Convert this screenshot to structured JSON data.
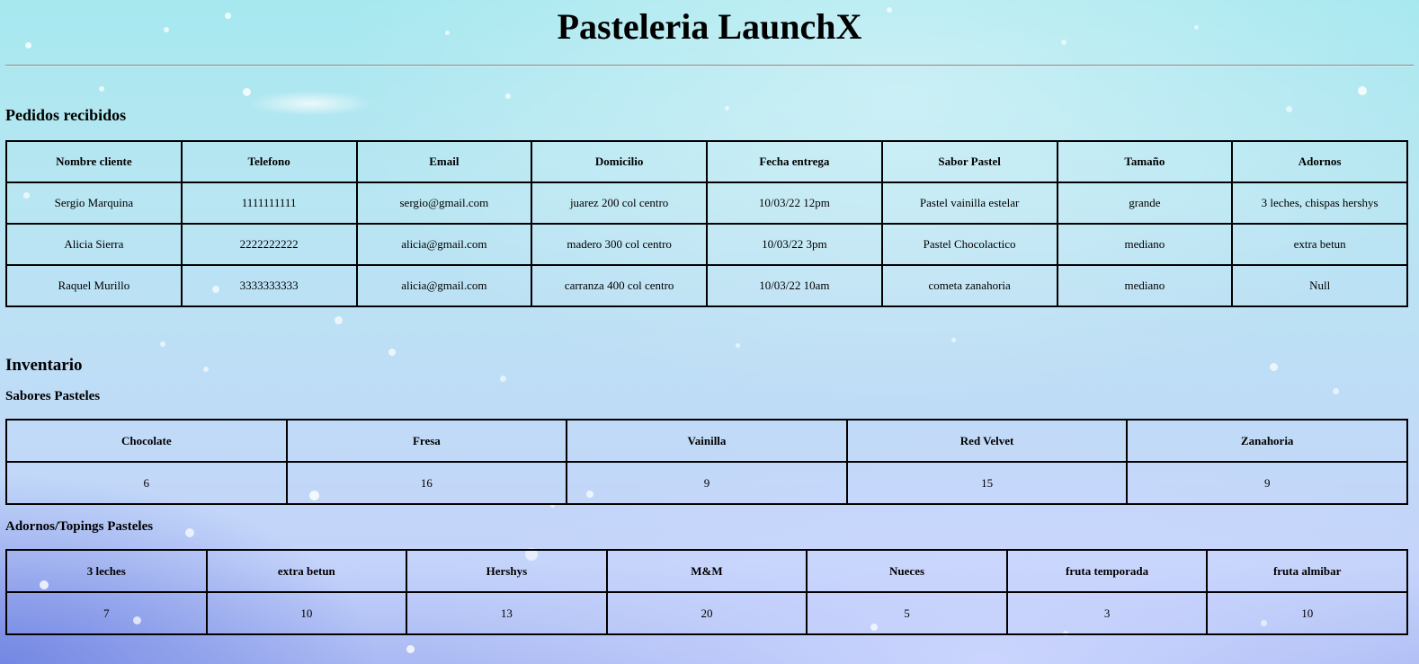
{
  "page": {
    "title": "Pasteleria LaunchX"
  },
  "orders": {
    "heading": "Pedidos recibidos",
    "columns": [
      "Nombre cliente",
      "Telefono",
      "Email",
      "Domicilio",
      "Fecha entrega",
      "Sabor Pastel",
      "Tamaño",
      "Adornos"
    ],
    "rows": [
      [
        "Sergio Marquina",
        "1111111111",
        "sergio@gmail.com",
        "juarez 200 col centro",
        "10/03/22 12pm",
        "Pastel vainilla estelar",
        "grande",
        "3 leches, chispas hershys"
      ],
      [
        "Alicia Sierra",
        "2222222222",
        "alicia@gmail.com",
        "madero 300 col centro",
        "10/03/22 3pm",
        "Pastel Chocolactico",
        "mediano",
        "extra betun"
      ],
      [
        "Raquel Murillo",
        "3333333333",
        "alicia@gmail.com",
        "carranza 400 col centro",
        "10/03/22 10am",
        "cometa zanahoria",
        "mediano",
        "Null"
      ]
    ]
  },
  "inventory": {
    "heading": "Inventario",
    "flavors": {
      "heading": "Sabores Pasteles",
      "columns": [
        "Chocolate",
        "Fresa",
        "Vainilla",
        "Red Velvet",
        "Zanahoria"
      ],
      "values": [
        "6",
        "16",
        "9",
        "15",
        "9"
      ]
    },
    "toppings": {
      "heading": "Adornos/Topings Pasteles",
      "columns": [
        "3 leches",
        "extra betun",
        "Hershys",
        "M&M",
        "Nueces",
        "fruta temporada",
        "fruta almibar"
      ],
      "values": [
        "7",
        "10",
        "13",
        "20",
        "5",
        "3",
        "10"
      ]
    }
  },
  "colors": {
    "background_top": "#a6e8ef",
    "background_bottom": "#aab9f3",
    "table_border": "#000000"
  }
}
